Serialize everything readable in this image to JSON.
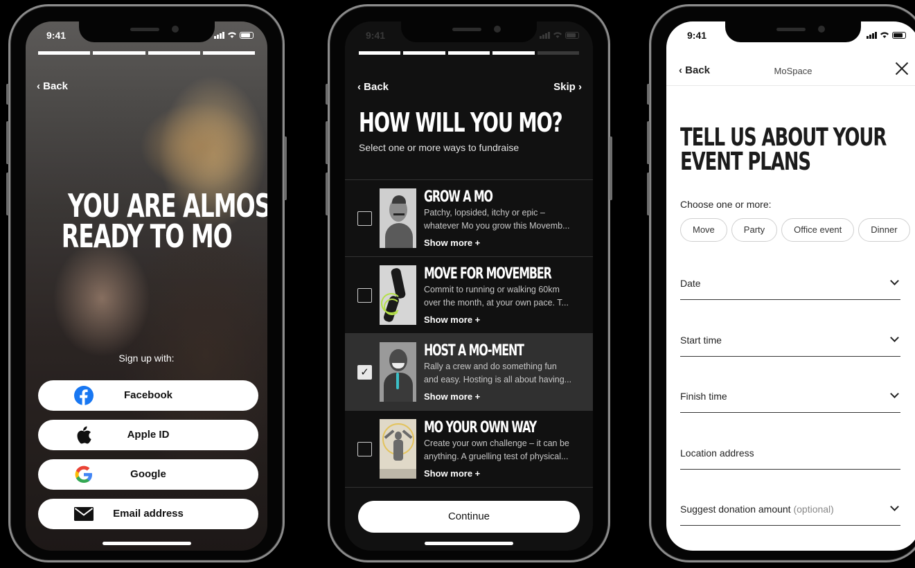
{
  "status": {
    "time": "9:41"
  },
  "screen1": {
    "back": "‹ Back",
    "headline": [
      "YOU ARE ALMOST",
      "READY TO MO"
    ],
    "signup_label": "Sign up with:",
    "buttons": [
      {
        "label": "Facebook",
        "icon": "facebook-icon"
      },
      {
        "label": "Apple ID",
        "icon": "apple-icon"
      },
      {
        "label": "Google",
        "icon": "google-icon"
      },
      {
        "label": "Email address",
        "icon": "envelope-icon"
      }
    ]
  },
  "screen2": {
    "back": "‹ Back",
    "skip": "Skip ›",
    "title": "HOW WILL YOU MO?",
    "subtitle": "Select one or more ways to fundraise",
    "options": [
      {
        "title": "GROW A MO",
        "line1": "Patchy, lopsided, itchy or epic –",
        "line2": "whatever Mo you grow this Movemb...",
        "more": "Show more +",
        "checked": false
      },
      {
        "title": "MOVE FOR MOVEMBER",
        "line1": "Commit to running or walking 60km",
        "line2": "over the month, at your own pace. T...",
        "more": "Show more +",
        "checked": false
      },
      {
        "title": "HOST A MO-MENT",
        "line1": "Rally a crew and do something fun",
        "line2": "and easy. Hosting is all about having...",
        "more": "Show more +",
        "checked": true
      },
      {
        "title": "MO YOUR OWN WAY",
        "line1": "Create your own challenge – it can be",
        "line2": "anything. A gruelling test of physical...",
        "more": "Show more +",
        "checked": false
      }
    ],
    "continue": "Continue",
    "check_mark": "✓"
  },
  "screen3": {
    "back": "‹ Back",
    "nav_title": "MoSpace",
    "title": [
      "TELL US ABOUT YOUR",
      "EVENT PLANS"
    ],
    "choose": "Choose one or more:",
    "chips": [
      "Move",
      "Party",
      "Office event",
      "Dinner"
    ],
    "fields": {
      "date": "Date",
      "start": "Start time",
      "finish": "Finish time",
      "location": "Location address",
      "donation": "Suggest donation amount",
      "donation_optional": "(optional)"
    }
  },
  "colors": {
    "accent_dark": "#111111",
    "selected_row": "#303030",
    "text_light": "#ffffff"
  }
}
